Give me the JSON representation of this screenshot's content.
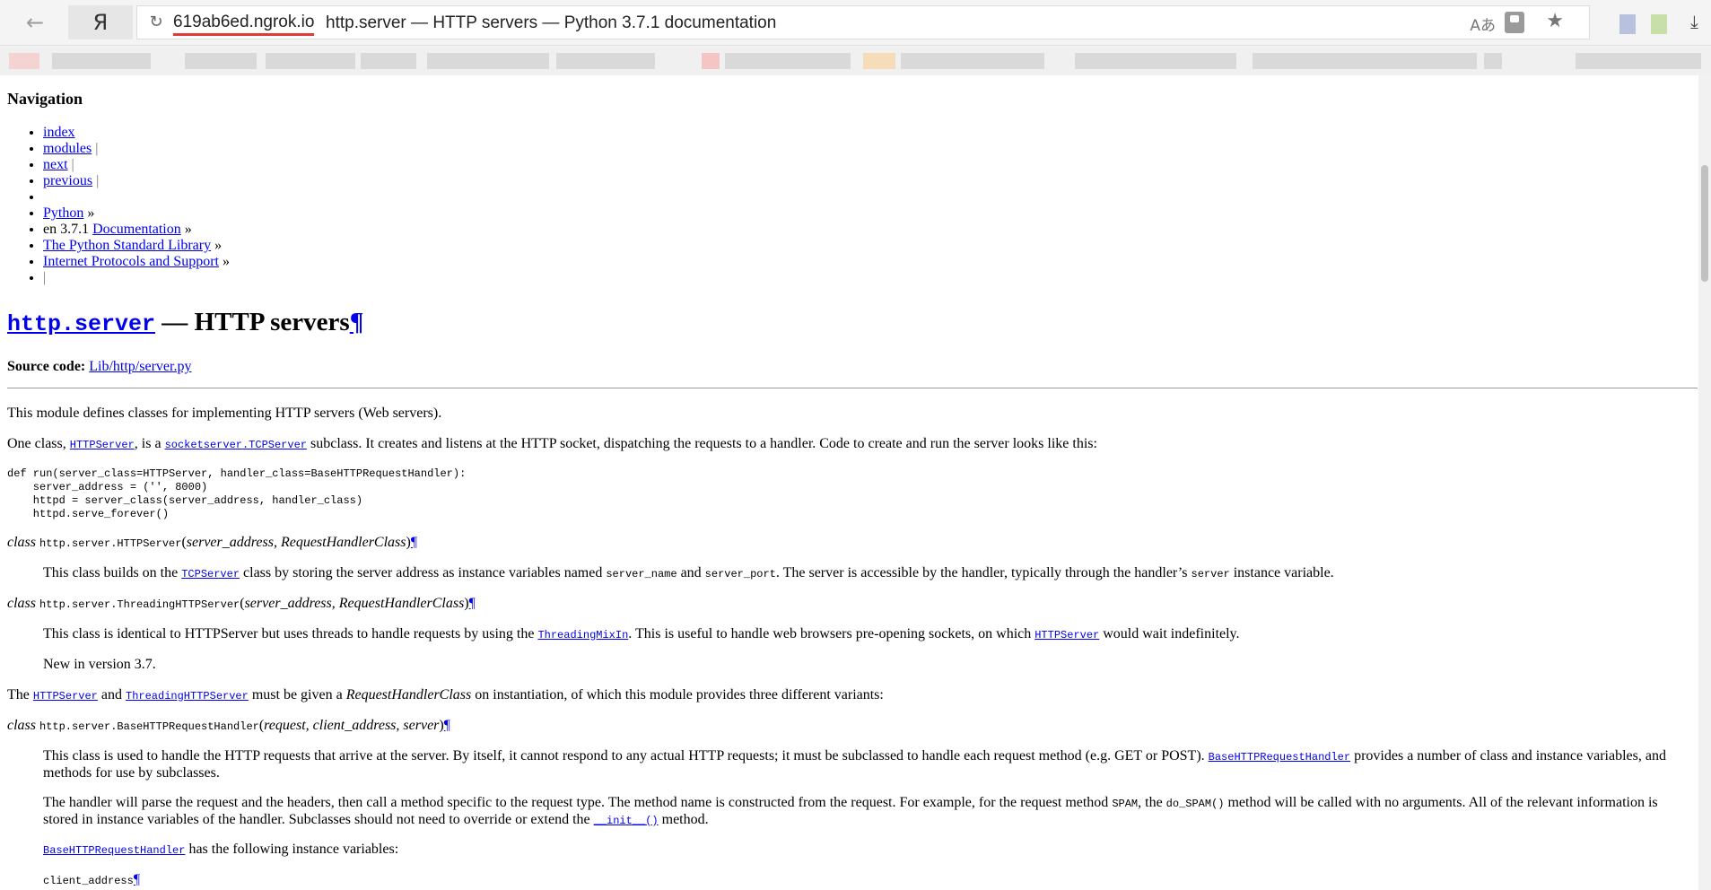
{
  "browser": {
    "back_icon": "arrow-left-icon",
    "yandex_label": "Я",
    "host": "619ab6ed.ngrok.io",
    "title": "http.server — HTTP servers — Python 3.7.1 documentation"
  },
  "nav": {
    "heading": "Navigation",
    "index": "index",
    "modules": "modules",
    "next": "next",
    "previous": "previous",
    "python": "Python",
    "version_prefix": "en 3.7.1",
    "documentation": "Documentation",
    "stdlib": "The Python Standard Library",
    "protocols": "Internet Protocols and Support",
    "sep_pipe": "|",
    "sep_raquo": "»"
  },
  "doc": {
    "h1_code": "http.server",
    "h1_text": " — HTTP servers",
    "pilcrow": "¶",
    "source_label": "Source code:",
    "source_link": "Lib/http/server.py",
    "p1": "This module defines classes for implementing HTTP servers (Web servers).",
    "p2_a": "One class, ",
    "p2_link1": "HTTPServer",
    "p2_b": ", is a ",
    "p2_link2": "socketserver.TCPServer",
    "p2_c": " subclass. It creates and listens at the HTTP socket, dispatching the requests to a handler. Code to create and run the server looks like this:",
    "code_block": "def run(server_class=HTTPServer, handler_class=BaseHTTPRequestHandler):\n    server_address = ('', 8000)\n    httpd = server_class(server_address, handler_class)\n    httpd.serve_forever()",
    "sig1_class": "class ",
    "sig1_name": "http.server.HTTPServer",
    "sig1_params": "server_address, RequestHandlerClass",
    "d1_a": "This class builds on the ",
    "d1_link": "TCPServer",
    "d1_b": " class by storing the server address as instance variables named ",
    "d1_code1": "server_name",
    "d1_c": " and ",
    "d1_code2": "server_port",
    "d1_d": ". The server is accessible by the handler, typically through the handler’s ",
    "d1_code3": "server",
    "d1_e": " instance variable.",
    "sig2_name": "http.server.ThreadingHTTPServer",
    "sig2_params": "server_address, RequestHandlerClass",
    "d2_a": "This class is identical to HTTPServer but uses threads to handle requests by using the ",
    "d2_link1": "ThreadingMixIn",
    "d2_b": ". This is useful to handle web browsers pre-opening sockets, on which ",
    "d2_link2": "HTTPServer",
    "d2_c": " would wait indefinitely.",
    "d2_new": "New in version 3.7.",
    "p3_a": "The ",
    "p3_link1": "HTTPServer",
    "p3_b": " and ",
    "p3_link2": "ThreadingHTTPServer",
    "p3_c": " must be given a ",
    "p3_em": "RequestHandlerClass",
    "p3_d": " on instantiation, of which this module provides three different variants:",
    "sig3_name": "http.server.BaseHTTPRequestHandler",
    "sig3_params": "request, client_address, server",
    "d3_a": "This class is used to handle the HTTP requests that arrive at the server. By itself, it cannot respond to any actual HTTP requests; it must be subclassed to handle each request method (e.g. GET or POST). ",
    "d3_link": "BaseHTTPRequestHandler",
    "d3_b": " provides a number of class and instance variables, and methods for use by subclasses.",
    "d4_a": "The handler will parse the request and the headers, then call a method specific to the request type. The method name is constructed from the request. For example, for the request method ",
    "d4_code1": "SPAM",
    "d4_b": ", the ",
    "d4_code2": "do_SPAM()",
    "d4_c": " method will be called with no arguments. All of the relevant information is stored in instance variables of the handler. Subclasses should not need to override or extend the ",
    "d4_link": "__init__()",
    "d4_d": " method.",
    "d5_link": "BaseHTTPRequestHandler",
    "d5_b": " has the following instance variables:",
    "attr_name": "client_address"
  }
}
